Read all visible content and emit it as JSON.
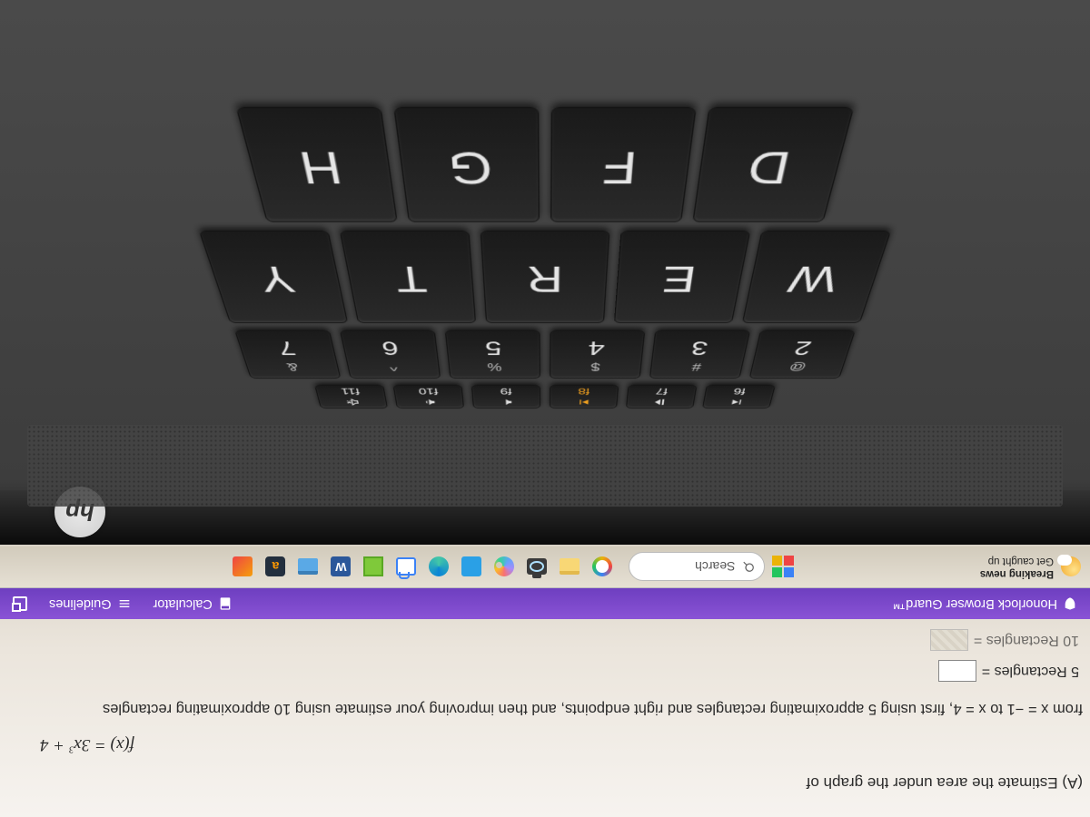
{
  "problem": {
    "part_label": "(A)",
    "prompt_text": "Estimate the area under the graph of",
    "function_tex": "f(x) = 3x³ + 4",
    "range_text": "from x = −1 to x = 4, first using 5 approximating rectangles and right endpoints, and then improving your estimate using 10 approximating rectangles",
    "answer_5_label": "5 Rectangles =",
    "answer_10_label": "10 Rectangles ="
  },
  "purple_bar": {
    "left": "Honorlock Browser Guard™",
    "calculator": "Calculator",
    "guidelines": "Guidelines"
  },
  "taskbar": {
    "weather_line1": "Breaking news",
    "weather_line2": "Get caught up",
    "search_placeholder": "Search"
  },
  "keyboard": {
    "fnrow": [
      {
        "sub": "f6"
      },
      {
        "sub": "f7"
      },
      {
        "sub": "f8"
      },
      {
        "sub": "f9"
      },
      {
        "sub": "f10"
      },
      {
        "sub": "f11"
      }
    ],
    "numrow": [
      {
        "top": "@",
        "bot": "2"
      },
      {
        "top": "#",
        "bot": "3"
      },
      {
        "top": "$",
        "bot": "4"
      },
      {
        "top": "%",
        "bot": "5"
      },
      {
        "top": "^",
        "bot": "6"
      },
      {
        "top": "&",
        "bot": "7"
      }
    ],
    "letrow": [
      "W",
      "E",
      "R",
      "T",
      "Y"
    ],
    "letrow2": [
      "D",
      "F",
      "G",
      "H"
    ]
  },
  "logo": "hp"
}
